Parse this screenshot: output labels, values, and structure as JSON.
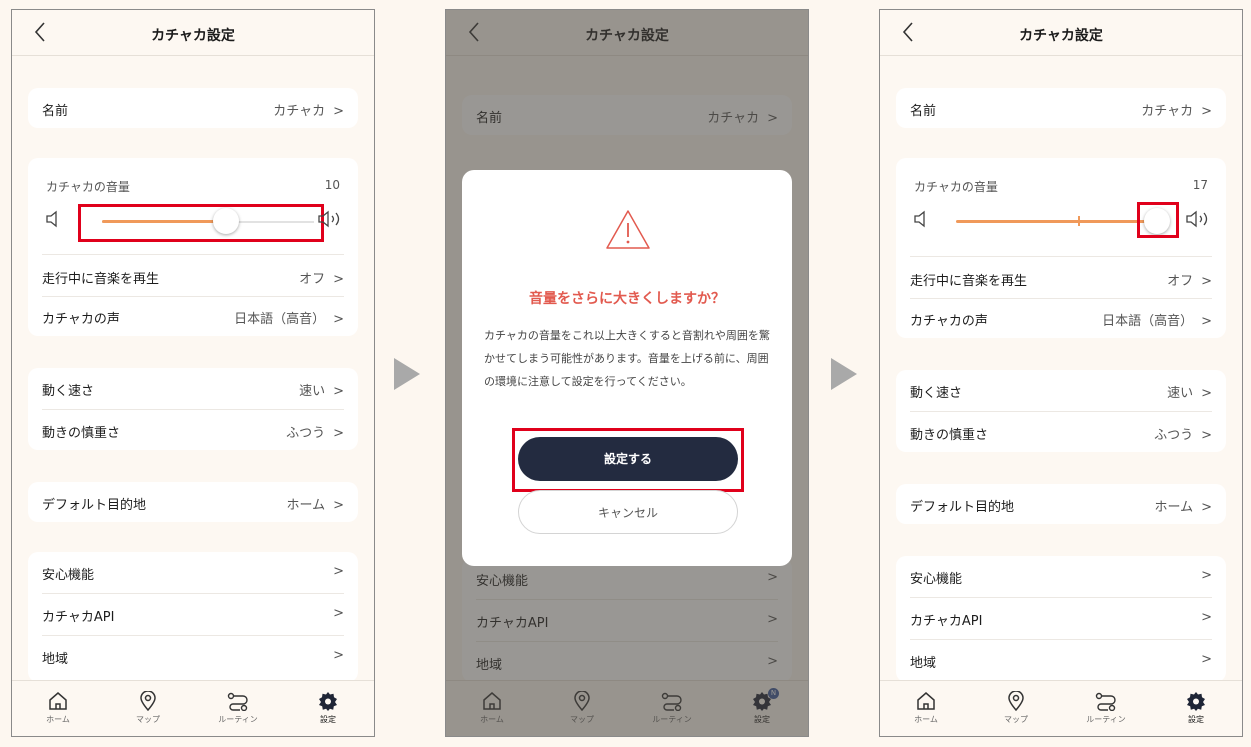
{
  "header": {
    "title": "カチャカ設定"
  },
  "rows": {
    "name": {
      "label": "名前",
      "value": "カチャカ"
    },
    "volume": {
      "label": "カチャカの音量"
    },
    "music": {
      "label": "走行中に音楽を再生",
      "value": "オフ"
    },
    "voice": {
      "label": "カチャカの声",
      "value": "日本語（高音）"
    },
    "speed": {
      "label": "動く速さ",
      "value": "速い"
    },
    "caution": {
      "label": "動きの慎重さ",
      "value": "ふつう"
    },
    "destination": {
      "label": "デフォルト目的地",
      "value": "ホーム"
    },
    "safety": {
      "label": "安心機能"
    },
    "api": {
      "label": "カチャカAPI"
    },
    "region": {
      "label": "地域"
    }
  },
  "screens": [
    {
      "volume_value": "10",
      "volume_fraction": 0.55
    },
    {
      "volume_value": "",
      "volume_fraction": 0.55
    },
    {
      "volume_value": "17",
      "volume_fraction": 1.0
    }
  ],
  "chevron": ">",
  "tabs": [
    {
      "label": "ホーム",
      "icon": "home-icon"
    },
    {
      "label": "マップ",
      "icon": "map-pin-icon"
    },
    {
      "label": "ルーティン",
      "icon": "routine-icon"
    },
    {
      "label": "設定",
      "icon": "gear-icon"
    }
  ],
  "modal": {
    "title": "音量をさらに大きくしますか？",
    "body": "カチャカの音量をこれ以上大きくすると音割れや周囲を驚かせてしまう可能性があります。音量を上げる前に、周囲の環境に注意して設定を行ってください。",
    "confirm": "設定する",
    "cancel": "キャンセル"
  },
  "notification_badge": "N",
  "colors": {
    "accent": "#f0995a",
    "primary_button": "#232b40",
    "warning": "#e25a4f",
    "highlight": "#e0001b"
  }
}
